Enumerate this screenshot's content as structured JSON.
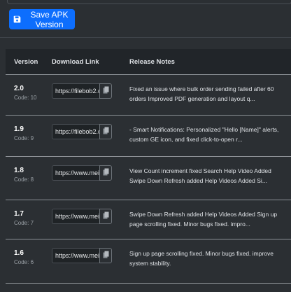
{
  "actions": {
    "save_label": "Save APK Version"
  },
  "table": {
    "headers": {
      "version": "Version",
      "download_link": "Download Link",
      "release_notes": "Release Notes"
    },
    "rows": [
      {
        "version": "2.0",
        "code": "Code: 10",
        "link": "https://filebob2.c",
        "notes": "Fixed an issue where bulk order sending failed after 60 orders Improved PDF generation and layout q..."
      },
      {
        "version": "1.9",
        "code": "Code: 9",
        "link": "https://filebob2.c",
        "notes": "- Smart Notifications: Personalized \"Hello [Name]\" alerts, custom GE icon, and fixed click-to-open r..."
      },
      {
        "version": "1.8",
        "code": "Code: 8",
        "link": "https://www.mei",
        "notes": "View Count increment fixed Search Help Video Added Swipe Down Refresh added Help Videos Added Si..."
      },
      {
        "version": "1.7",
        "code": "Code: 7",
        "link": "https://www.mei",
        "notes": "Swipe Down Refresh added Help Videos Added Sign up page scrolling fixed. Minor bugs fixed. impro..."
      },
      {
        "version": "1.6",
        "code": "Code: 6",
        "link": "https://www.mei",
        "notes": "Sign up page scrolling fixed. Minor bugs fixed. improve system stability."
      }
    ]
  },
  "icons": {
    "save": "floppy-disk-icon",
    "copy": "copy-icon"
  },
  "colors": {
    "background": "#2b2f33",
    "header_bg": "#212529",
    "primary": "#0d6efd"
  }
}
